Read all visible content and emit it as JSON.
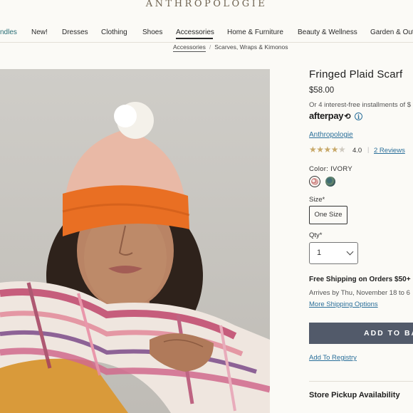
{
  "header": {
    "logo": "ANTHROPOLOGIE"
  },
  "nav": {
    "items": [
      "ndles",
      "New!",
      "Dresses",
      "Clothing",
      "Shoes",
      "Accessories",
      "Home & Furniture",
      "Beauty & Wellness",
      "Garden & Out"
    ],
    "active": "Accessories"
  },
  "breadcrumb": {
    "items": [
      "Accessories",
      "Scarves, Wraps & Kimonos"
    ],
    "separator": "/"
  },
  "product": {
    "title": "Fringed Plaid Scarf",
    "price": "$58.00",
    "installments": "Or 4 interest-free installments of $",
    "afterpay": "afterpay",
    "info_icon": "i",
    "brand": "Anthropologie",
    "rating": "4.0",
    "rating_stars_filled": "★★★★",
    "rating_stars_empty": "★",
    "rating_sep": "|",
    "reviews": "2 Reviews",
    "color_label": "Color: IVORY",
    "size_label": "Size*",
    "size_option": "One Size",
    "qty_label": "Qty*",
    "qty_value": "1",
    "shipping": "Free Shipping on Orders $50+",
    "arrives": "Arrives by Thu, November 18 to 6",
    "more_shipping": "More Shipping Options",
    "add_to_bag": "ADD TO BAS",
    "registry": "Add To Registry",
    "store_pickup": "Store Pickup Availability"
  },
  "colors": {
    "accent_link": "#2a6f9a",
    "nav_teal": "#2a6f76",
    "button_bg": "#525a6a",
    "star": "#c8a96a",
    "logo": "#6e6250"
  }
}
